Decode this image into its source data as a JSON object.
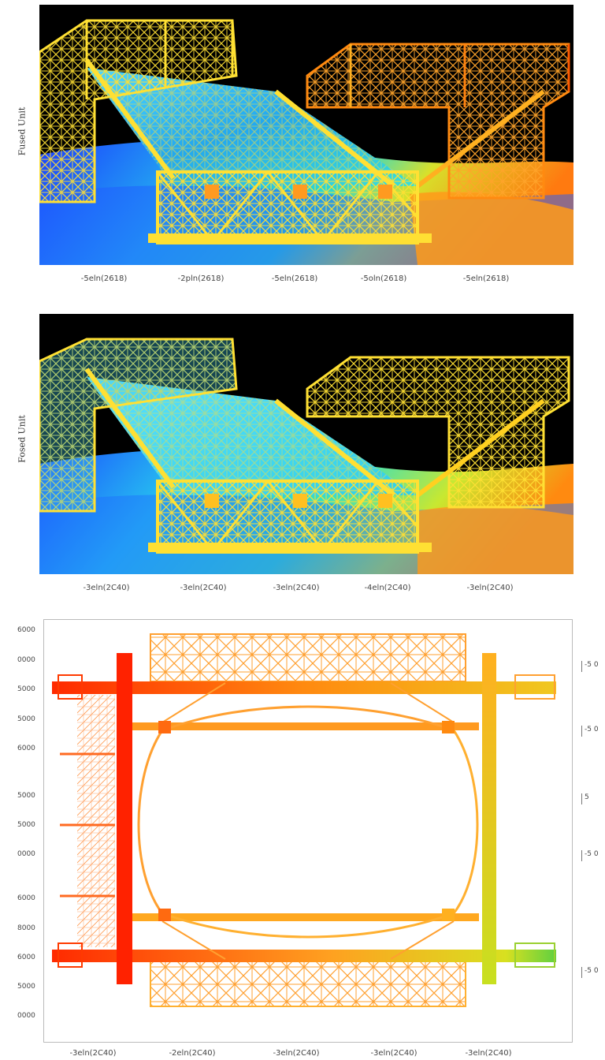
{
  "panels": [
    {
      "id": "top",
      "ylabel": "Fused Unit",
      "xticks": [
        "-5eln(2618)",
        "-2pln(2618)",
        "-5eln(2618)",
        "-5oln(2618)",
        "-5eln(2618)"
      ]
    },
    {
      "id": "middle",
      "ylabel": "Fosed Unit",
      "xticks": [
        "-3eln(2C40)",
        "-3eln(2C40)",
        "-3eln(2C40)",
        "-4eln(2C40)",
        "-3eln(2C40)"
      ]
    },
    {
      "id": "bottom",
      "yticks": [
        "6000",
        "0000",
        "5000",
        "5000",
        "6000",
        "5000",
        "5000",
        "0000",
        "6000",
        "8000",
        "6000",
        "5000",
        "0000"
      ],
      "rticks": [
        "-5 0",
        "-5 0",
        "5",
        "-5 0",
        "-5 0"
      ],
      "xticks": [
        "-3eln(2C40)",
        "-2eln(2C40)",
        "-3eln(2C40)",
        "-3eln(2C40)",
        "-3eln(2C40)"
      ]
    }
  ],
  "colors": {
    "background": "#000000",
    "cool": "#1a5cff",
    "mid": "#27d6e6",
    "warm": "#ffd21e",
    "hot": "#ff6a00",
    "red": "#ff2200"
  }
}
